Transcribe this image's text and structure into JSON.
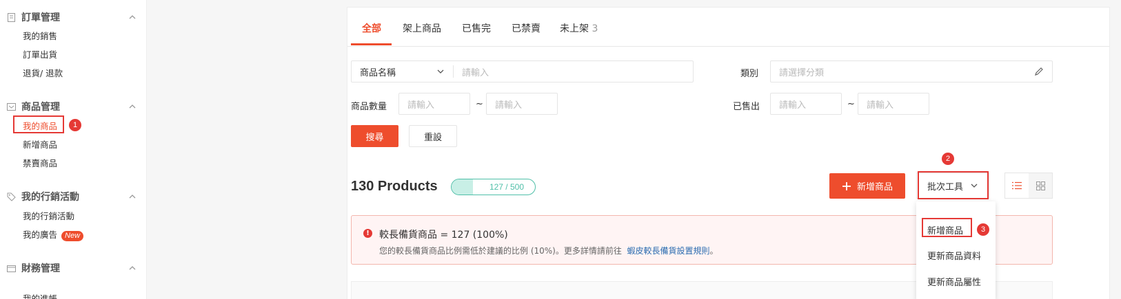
{
  "sidebar": {
    "sections": [
      {
        "title": "訂單管理",
        "icon": "order-icon",
        "items": [
          "我的銷售",
          "訂單出貨",
          "退貨/ 退款"
        ]
      },
      {
        "title": "商品管理",
        "icon": "product-icon",
        "items": [
          "我的商品",
          "新增商品",
          "禁賣商品"
        ]
      },
      {
        "title": "我的行銷活動",
        "icon": "tag-icon",
        "items": [
          "我的行銷活動",
          "我的廣告"
        ]
      },
      {
        "title": "財務管理",
        "icon": "wallet-icon",
        "items": [
          "我的進帳"
        ]
      }
    ],
    "new_badge": "New",
    "step1": "1"
  },
  "tabs": [
    {
      "label": "全部",
      "count": ""
    },
    {
      "label": "架上商品",
      "count": ""
    },
    {
      "label": "已售完",
      "count": ""
    },
    {
      "label": "已禁賣",
      "count": ""
    },
    {
      "label": "未上架",
      "count": "3"
    }
  ],
  "filters": {
    "name_select": "商品名稱",
    "name_placeholder": "請輸入",
    "category_label": "類別",
    "category_placeholder": "請選擇分類",
    "qty_label": "商品數量",
    "qty_min_placeholder": "請輸入",
    "qty_max_placeholder": "請輸入",
    "sold_label": "已售出",
    "sold_min_placeholder": "請輸入",
    "sold_max_placeholder": "請輸入",
    "tilde": "~",
    "search_button": "搜尋",
    "reset_button": "重設"
  },
  "summary": {
    "count_title": "130 Products",
    "quota_text": "127 / 500",
    "quota_fraction": 0.254,
    "add_button": "新增商品",
    "batch_button": "批次工具",
    "step2": "2"
  },
  "alert": {
    "title": "較長備貨商品 = 127 (100%)",
    "desc": "您的較長備貨商品比例需低於建議的比例 (10%)。更多詳情請前往",
    "link": "蝦皮較長備貨設置規則",
    "suffix": "。"
  },
  "dropdown": {
    "items": [
      "新增商品",
      "更新商品資料",
      "更新商品屬性"
    ],
    "step3": "3"
  },
  "colors": {
    "accent": "#ee4d2d",
    "annotation": "#e53935",
    "quota": "#4fbfa8"
  }
}
